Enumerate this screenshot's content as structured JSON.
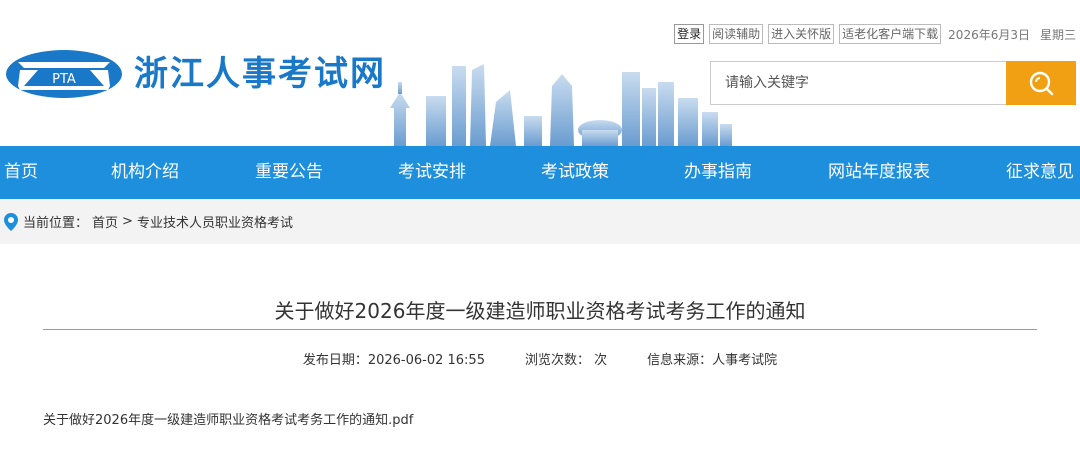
{
  "header": {
    "logo_badge": "PTA",
    "site_title": "浙江人事考试网",
    "colors": {
      "brand": "#1a78c8",
      "accent": "#f0a012",
      "nav_bg": "#1e8fdd"
    }
  },
  "toplinks": {
    "login": "登录",
    "reading_aid": "阅读辅助",
    "care_version": "进入关怀版",
    "elderly_client": "适老化客户端下载",
    "date": "2026年6月3日",
    "weekday": "星期三"
  },
  "search": {
    "placeholder": "请输入关键字",
    "icon": "search-icon"
  },
  "nav": {
    "items": [
      "首页",
      "机构介绍",
      "重要公告",
      "考试安排",
      "考试政策",
      "办事指南",
      "网站年度报表",
      "征求意见"
    ]
  },
  "breadcrumb": {
    "label": "当前位置：",
    "home": "首页",
    "sep": ">",
    "current": "专业技术人员职业资格考试"
  },
  "article": {
    "title": "关于做好2026年度一级建造师职业资格考试考务工作的通知",
    "publish_label": "发布日期：",
    "publish_date": "2026-06-02 16:55",
    "views_label": "浏览次数：",
    "views_unit": "次",
    "source_label": "信息来源：",
    "source": "人事考试院",
    "attachment": "关于做好2026年度一级建造师职业资格考试考务工作的通知.pdf"
  }
}
